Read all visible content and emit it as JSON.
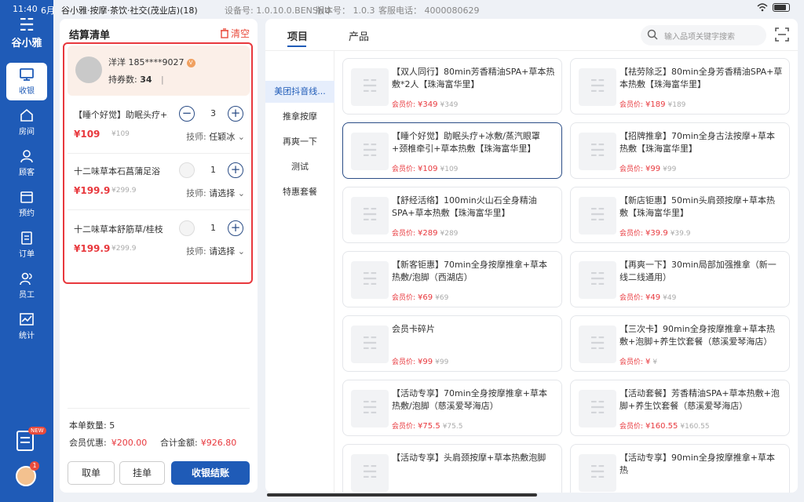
{
  "status": {
    "time": "11:40",
    "date": "6月",
    "store": "谷小雅·按摩·茶饮·社交(茂业店)(18)",
    "device": "设备号: 1.0.10.0.BENSHU",
    "version": "版本号： 1.0.3",
    "phone": "客服电话： 4000080629"
  },
  "logo": {
    "text": "谷小雅"
  },
  "nav": [
    {
      "label": "收银",
      "icon": "monitor-icon"
    },
    {
      "label": "房间",
      "icon": "house-icon"
    },
    {
      "label": "顾客",
      "icon": "person-icon"
    },
    {
      "label": "预约",
      "icon": "calendar-icon"
    },
    {
      "label": "订单",
      "icon": "clipboard-icon"
    },
    {
      "label": "员工",
      "icon": "people-icon"
    },
    {
      "label": "统计",
      "icon": "chart-icon"
    }
  ],
  "nav_bottom": {
    "new_badge": "NEW",
    "notify_count": "1"
  },
  "cart": {
    "title": "结算清单",
    "clear": "清空",
    "member": {
      "name": "洋洋 185****9027",
      "coupon_label": "持券数:",
      "coupon_count": "34",
      "cursor": "|"
    },
    "items": [
      {
        "name": "【睡个好觉】助眠头疗+冰敷",
        "price": "¥109",
        "orig": "¥109",
        "qty": "3",
        "tech_label": "技师:",
        "tech_value": "任颖冰"
      },
      {
        "name": "十二味草本石菖蒲足浴",
        "price": "¥199.9",
        "orig": "¥299.9",
        "qty": "1",
        "tech_label": "技师:",
        "tech_value": "请选择"
      },
      {
        "name": "十二味草本舒筋草/桂枝",
        "price": "¥199.9",
        "orig": "¥299.9",
        "qty": "1",
        "tech_label": "技师:",
        "tech_value": "请选择"
      }
    ],
    "count_label": "本单数量:",
    "count": "5",
    "discount_label": "会员优惠:",
    "discount": "¥200.00",
    "total_label": "合计金额:",
    "total": "¥926.80",
    "btn_take": "取单",
    "btn_hang": "挂单",
    "btn_checkout": "收银结账"
  },
  "main": {
    "tabs": [
      "项目",
      "产品"
    ],
    "search_placeholder": "输入品项关键字搜索",
    "categories": [
      "美团抖音线...",
      "推拿按摩",
      "再爽一下",
      "测试",
      "特惠套餐"
    ],
    "price_label": "会员价:",
    "cards": [
      {
        "name": "【双人同行】80min芳香精油SPA+草本热敷*2人【珠海富华里】",
        "price": "¥349",
        "orig": "¥349"
      },
      {
        "name": "【祛劳除乏】80min全身芳香精油SPA+草本热敷【珠海富华里】",
        "price": "¥189",
        "orig": "¥189"
      },
      {
        "name": "【睡个好觉】助眠头疗+冰敷/蒸汽眼罩+颈椎牵引+草本热敷【珠海富华里】",
        "price": "¥109",
        "orig": "¥109"
      },
      {
        "name": "【招牌推拿】70min全身古法按摩+草本热敷【珠海富华里】",
        "price": "¥99",
        "orig": "¥99"
      },
      {
        "name": "【舒经活络】100min火山石全身精油SPA+草本热敷【珠海富华里】",
        "price": "¥289",
        "orig": "¥289"
      },
      {
        "name": "【新店钜惠】50min头肩颈按摩+草本热敷【珠海富华里】",
        "price": "¥39.9",
        "orig": "¥39.9"
      },
      {
        "name": "【新客钜惠】70min全身按摩推拿+草本热敷/泡脚（西湖店）",
        "price": "¥69",
        "orig": "¥69"
      },
      {
        "name": "【再爽一下】30min局部加强推拿（新一线二线通用）",
        "price": "¥49",
        "orig": "¥49"
      },
      {
        "name": "会员卡碎片",
        "price": "¥99",
        "orig": "¥99"
      },
      {
        "name": "【三次卡】90min全身按摩推拿+草本热敷+泡脚+养生饮套餐（慈溪爱琴海店）",
        "price": "¥",
        "orig": "¥"
      },
      {
        "name": "【活动专享】70min全身按摩推拿+草本热敷/泡脚（慈溪爱琴海店）",
        "price": "¥75.5",
        "orig": "¥75.5"
      },
      {
        "name": "【活动套餐】芳香精油SPA+草本热敷+泡脚+养生饮套餐（慈溪爱琴海店）",
        "price": "¥160.55",
        "orig": "¥160.55"
      },
      {
        "name": "【活动专享】头肩颈按摩+草本热敷泡脚",
        "price": "",
        "orig": ""
      },
      {
        "name": "【活动专享】90min全身按摩推拿+草本热",
        "price": "",
        "orig": ""
      }
    ]
  }
}
